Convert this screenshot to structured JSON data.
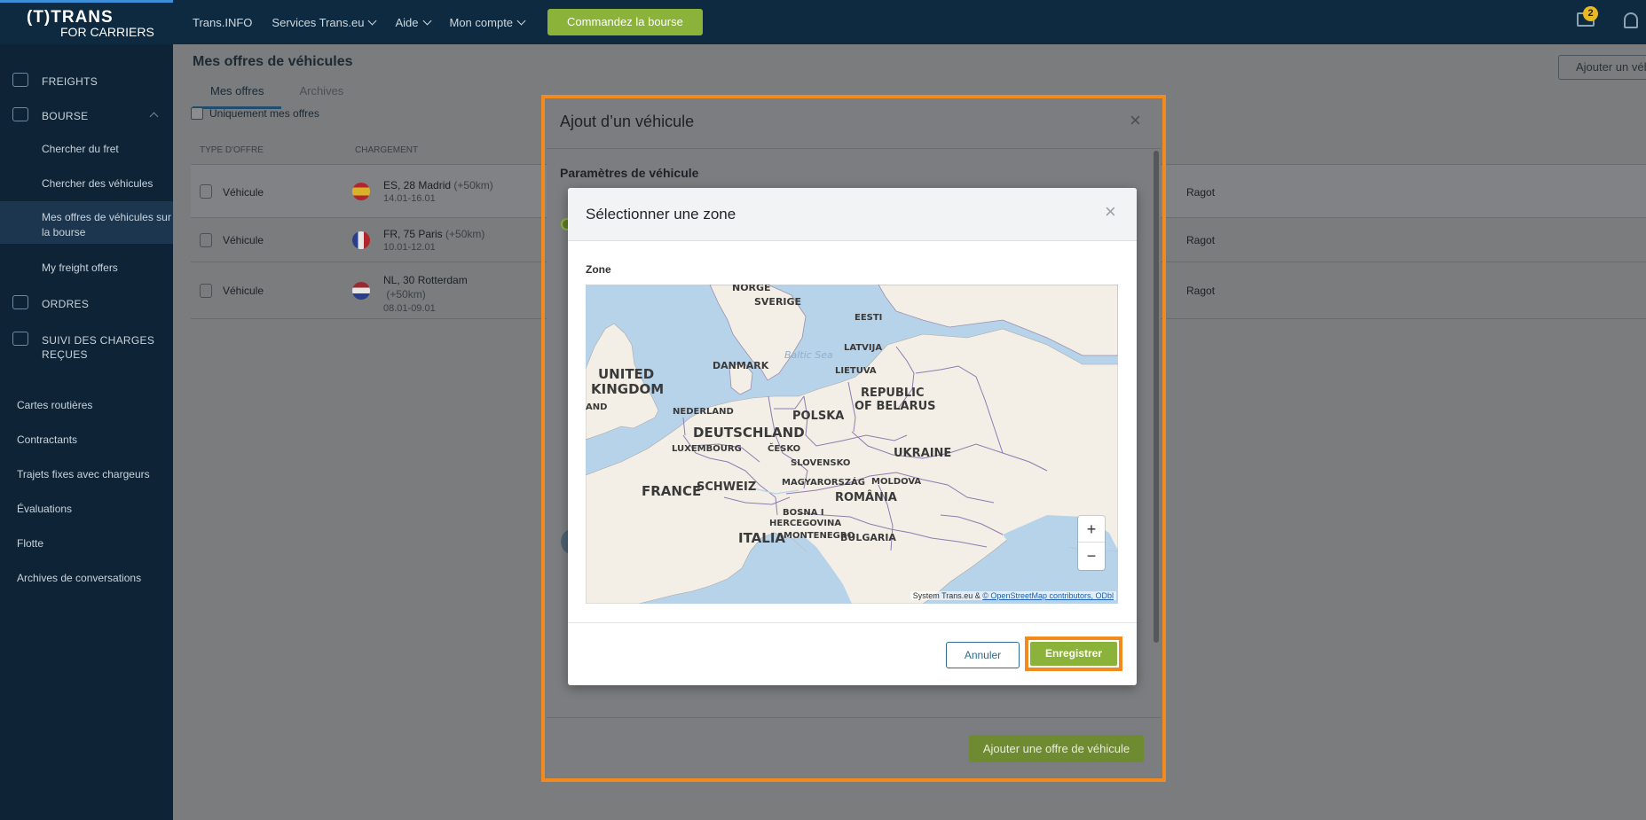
{
  "topbar": {
    "logo_line1": "(T)TRANS",
    "logo_line2": "FOR CARRIERS",
    "nav": [
      "Trans.INFO",
      "Services Trans.eu",
      "Aide",
      "Mon compte"
    ],
    "cta": "Commandez la bourse",
    "chat_badge": "2"
  },
  "sidebar": {
    "main": [
      "FREIGHTS",
      "BOURSE",
      "ORDRES",
      "SUIVI DES CHARGES REÇUES"
    ],
    "bourse_sub": [
      "Chercher du fret",
      "Chercher des véhicules",
      "Mes offres de véhicules sur la bourse",
      "My freight offers"
    ],
    "plain": [
      "Cartes routières",
      "Contractants",
      "Trajets fixes avec chargeurs",
      "Évaluations",
      "Flotte",
      "Archives de conversations"
    ]
  },
  "page": {
    "title": "Mes offres de véhicules",
    "tabs": [
      "Mes offres",
      "Archives"
    ],
    "add_button": "Ajouter un véh",
    "only_mine": "Uniquement mes offres",
    "columns": [
      "TYPE D'OFFRE",
      "CHARGEMENT"
    ],
    "rows": [
      {
        "type": "Véhicule",
        "loc": "ES, 28 Madrid",
        "km": "(+50km)",
        "date": "14.01-16.01",
        "person": "Ragot"
      },
      {
        "type": "Véhicule",
        "loc": "FR, 75 Paris",
        "km": "(+50km)",
        "date": "10.01-12.01",
        "person": "Ragot"
      },
      {
        "type": "Véhicule",
        "loc": "NL, 30 Rotterdam",
        "km": "(+50km)",
        "date": "08.01-09.01",
        "person": "Ragot"
      }
    ]
  },
  "outer_dialog": {
    "title": "Ajout d’un véhicule",
    "section": "Paramètres de véhicule",
    "submit": "Ajouter une offre de véhicule"
  },
  "modal": {
    "title": "Sélectionner une zone",
    "zone_label": "Zone",
    "cancel": "Annuler",
    "save": "Enregistrer",
    "zoom_in": "+",
    "zoom_out": "−",
    "attribution_prefix": "System Trans.eu &",
    "attribution_link": "© OpenStreetMap contributors, ODbl"
  },
  "map_labels": {
    "norge": "NORGE",
    "sverige": "SVERIGE",
    "eesti": "EESTI",
    "latvija": "LATVIJA",
    "danmark": "DANMARK",
    "lietuva": "LIETUVA",
    "uk1": "UNITED",
    "uk2": "KINGDOM",
    "land": "AND",
    "belarus1": "REPUBLIC",
    "belarus2": "OF BELARUS",
    "nederland": "NEDERLAND",
    "polska": "POLSKA",
    "deutschland": "DEUTSCHLAND",
    "luxembourg": "LUXEMBOURG",
    "cesko": "ČESKO",
    "ukraine": "UKRAINE",
    "slovensko": "SLOVENSKO",
    "france": "FRANCE",
    "schweiz": "SCHWEIZ",
    "magyar": "MAGYARORSZÁG",
    "moldova": "MOLDOVA",
    "romania": "ROMÂNIA",
    "bosna1": "BOSNA I",
    "bosna2": "HERCEGOVINA",
    "italia": "ITALIA",
    "montenegro": "MONTENEGRO",
    "bulgaria": "BULGARIA",
    "baltic": "Baltic Sea"
  }
}
